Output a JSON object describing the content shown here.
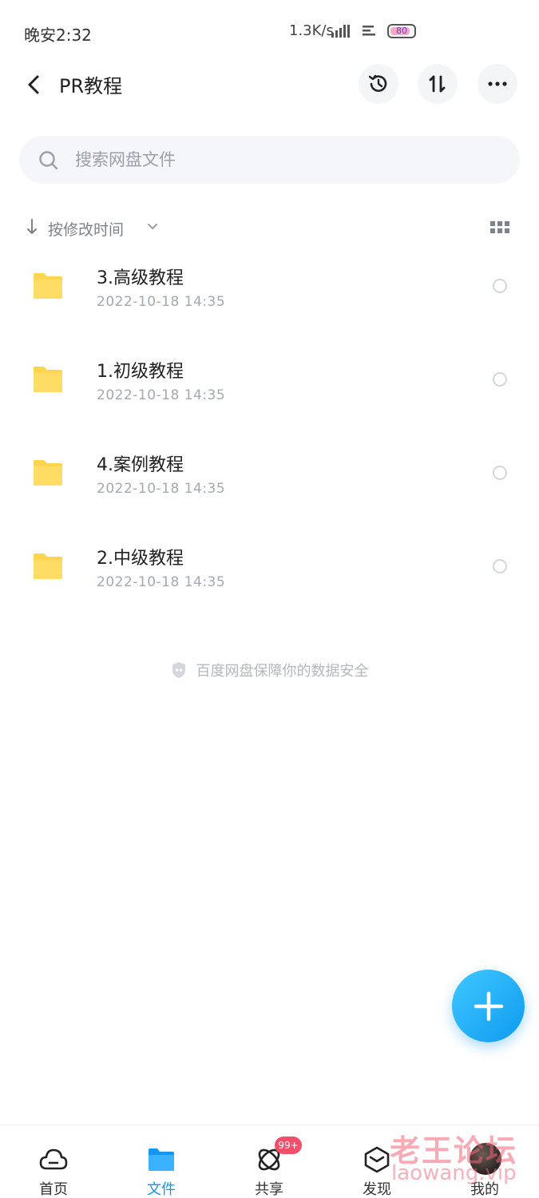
{
  "status_bar": {
    "time": "晚安2:32",
    "network_speed": "1.3K/s",
    "battery_level": "80"
  },
  "header": {
    "title": "PR教程",
    "history_icon": "history-icon",
    "sort_icon": "sort-icon",
    "more_icon": "more-icon"
  },
  "search": {
    "placeholder": "搜索网盘文件"
  },
  "sort_bar": {
    "label": "按修改时间"
  },
  "files": [
    {
      "name": "3.高级教程",
      "date": "2022-10-18  14:35",
      "icon": "folder-icon"
    },
    {
      "name": "1.初级教程",
      "date": "2022-10-18  14:35",
      "icon": "folder-icon"
    },
    {
      "name": "4.案例教程",
      "date": "2022-10-18  14:35",
      "icon": "folder-icon"
    },
    {
      "name": "2.中级教程",
      "date": "2022-10-18  14:35",
      "icon": "folder-icon"
    }
  ],
  "footer_note": "百度网盘保障你的数据安全",
  "nav": {
    "items": [
      {
        "label": "首页",
        "icon": "cloud-icon"
      },
      {
        "label": "文件",
        "icon": "folder-icon",
        "active": true
      },
      {
        "label": "共享",
        "icon": "share-icon",
        "badge": "99+"
      },
      {
        "label": "发现",
        "icon": "discover-icon"
      },
      {
        "label": "我的",
        "icon": "avatar"
      }
    ]
  },
  "watermark": {
    "cn": "老王论坛",
    "en": "laowang.vip"
  },
  "colors": {
    "accent": "#1496f0",
    "folder": "#ffd54f",
    "badge": "#f2506a"
  }
}
